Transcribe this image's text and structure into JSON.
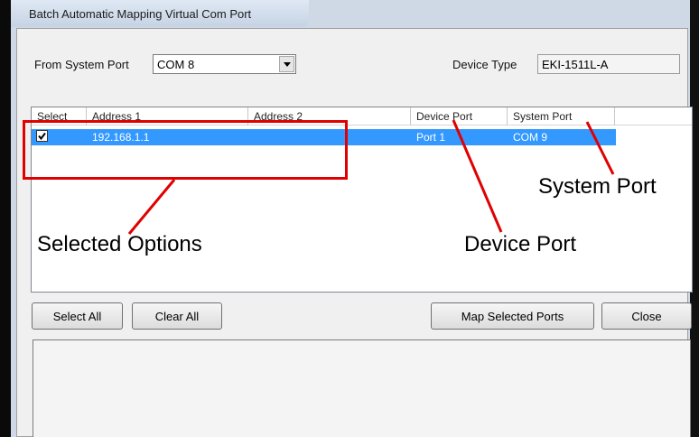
{
  "window": {
    "title": "Batch Automatic Mapping Virtual Com Port"
  },
  "from_port": {
    "label": "From System Port",
    "value": "COM 8"
  },
  "device_type": {
    "label": "Device Type",
    "value": "EKI-1511L-A"
  },
  "list": {
    "columns": [
      "Select",
      "Address 1",
      "Address 2",
      "Device Port",
      "System Port"
    ],
    "rows": [
      {
        "selected": true,
        "address1": "192.168.1.1",
        "address2": "",
        "device_port": "Port 1",
        "system_port": "COM 9"
      }
    ]
  },
  "buttons": {
    "select_all": "Select All",
    "clear_all": "Clear All",
    "map_selected": "Map Selected Ports",
    "close": "Close"
  },
  "annotations": {
    "selected_options": "Selected Options",
    "device_port": "Device Port",
    "system_port": "System Port",
    "color": "#e00000"
  },
  "colors": {
    "selection": "#3399ff"
  }
}
